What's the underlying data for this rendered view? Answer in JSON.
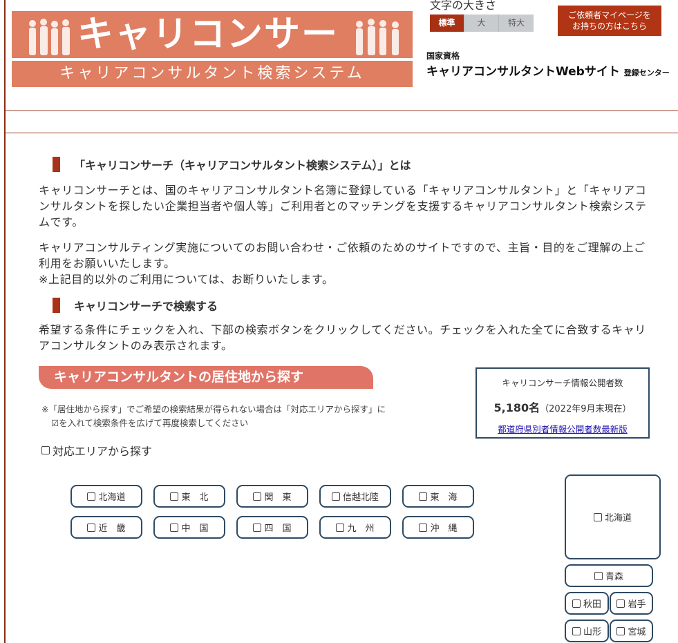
{
  "logo": {
    "title": "キャリコンサーチ",
    "subtitle": "キャリアコンサルタント検索システム"
  },
  "font_size": {
    "label": "文字の大きさ",
    "options": [
      "標準",
      "大",
      "特大"
    ],
    "selected": "標準"
  },
  "mypage_button": {
    "line1": "ご依頼者マイページを",
    "line2": "お持ちの方はこちら"
  },
  "site": {
    "qualification": "国家資格",
    "title": "キャリアコンサルタントWebサイト",
    "center": "登録センター"
  },
  "about": {
    "heading": "「キャリコンサーチ（キャリアコンサルタント検索システム）」とは",
    "para1": "キャリコンサーチとは、国のキャリアコンサルタント名簿に登録している「キャリアコンサルタント」と「キャリアコンサルタントを探したい企業担当者や個人等」ご利用者とのマッチングを支援するキャリアコンサルタント検索システムです。",
    "para2_line1": "キャリアコンサルティング実施についてのお問い合わせ・ご依頼のためのサイトですので、主旨・目的をご理解の上ご利用をお願いいたします。",
    "para2_line2": "※上記目的以外のご利用については、お断りいたします。"
  },
  "search": {
    "heading": "キャリコンサーチで検索する",
    "instructions": "希望する条件にチェックを入れ、下部の検索ボタンをクリックしてください。チェックを入れた全てに合致するキャリアコンサルタントのみ表示されます。"
  },
  "residence": {
    "banner": "キャリアコンサルタントの居住地から探す",
    "note_line1": "※「居住地から探す」でご希望の検索結果が得られない場合は「対応エリアから探す」に",
    "note_line2": "☑を入れて検索条件を広げて再度検索してください",
    "area_checkbox": "対応エリアから探す"
  },
  "stats": {
    "label": "キャリコンサーチ情報公開者数",
    "count": "5,180名",
    "as_of": "（2022年9月末現在）",
    "link": "都道府県別者情報公開者数最新版"
  },
  "regions": [
    "北海道",
    "東　北",
    "関　東",
    "信越北陸",
    "東　海",
    "近　畿",
    "中　国",
    "四　国",
    "九　州",
    "沖　縄"
  ],
  "prefectures": {
    "hokkaido": "北海道",
    "aomori": "青森",
    "akita": "秋田",
    "iwate": "岩手",
    "yamagata": "山形",
    "miyagi": "宮城"
  }
}
